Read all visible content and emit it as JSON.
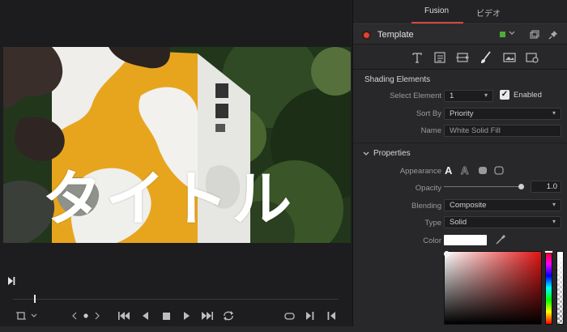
{
  "viewer": {
    "title_overlay": "タイトル"
  },
  "inspector": {
    "tabs": [
      {
        "label": "Fusion",
        "active": true
      },
      {
        "label": "ビデオ",
        "active": false
      }
    ],
    "node": {
      "name": "Template",
      "dot_color": "#e0452f",
      "tag_color": "#4caf33"
    },
    "mode_icons": [
      "text-icon",
      "layout-icon",
      "transform-icon",
      "shading-icon",
      "image-icon",
      "settings-icon"
    ],
    "shading": {
      "header": "Shading Elements",
      "select_element_label": "Select Element",
      "select_element_value": "1",
      "enabled_label": "Enabled",
      "enabled": true,
      "sort_by_label": "Sort By",
      "sort_by_value": "Priority",
      "name_label": "Name",
      "name_value": "White Solid Fill"
    },
    "properties": {
      "header": "Properties",
      "appearance_label": "Appearance",
      "opacity_label": "Opacity",
      "opacity_value": "1.0",
      "blending_label": "Blending",
      "blending_value": "Composite",
      "type_label": "Type",
      "type_value": "Solid",
      "color_label": "Color",
      "color_value": "#ffffff"
    },
    "accent_color": "#d2483e"
  }
}
